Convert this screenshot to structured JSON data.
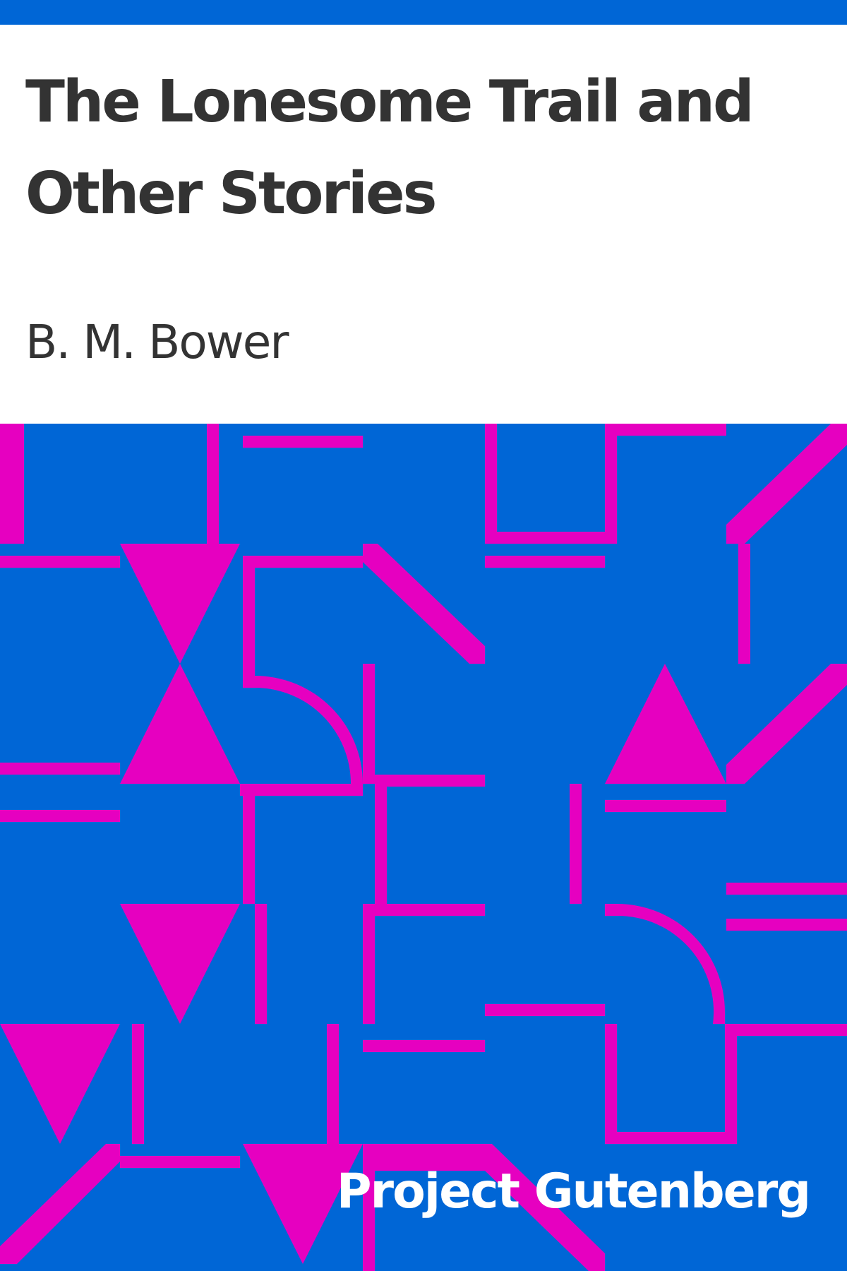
{
  "book": {
    "title": "The Lonesome Trail and Other Stories",
    "author": "B. M. Bower"
  },
  "publisher": {
    "name": "Project Gutenberg"
  },
  "colors": {
    "background_top": "#ffffff",
    "accent_blue": "#0066d6",
    "pattern_magenta": "#e600c0",
    "text_dark": "#333333",
    "brand_text": "#ffffff"
  }
}
